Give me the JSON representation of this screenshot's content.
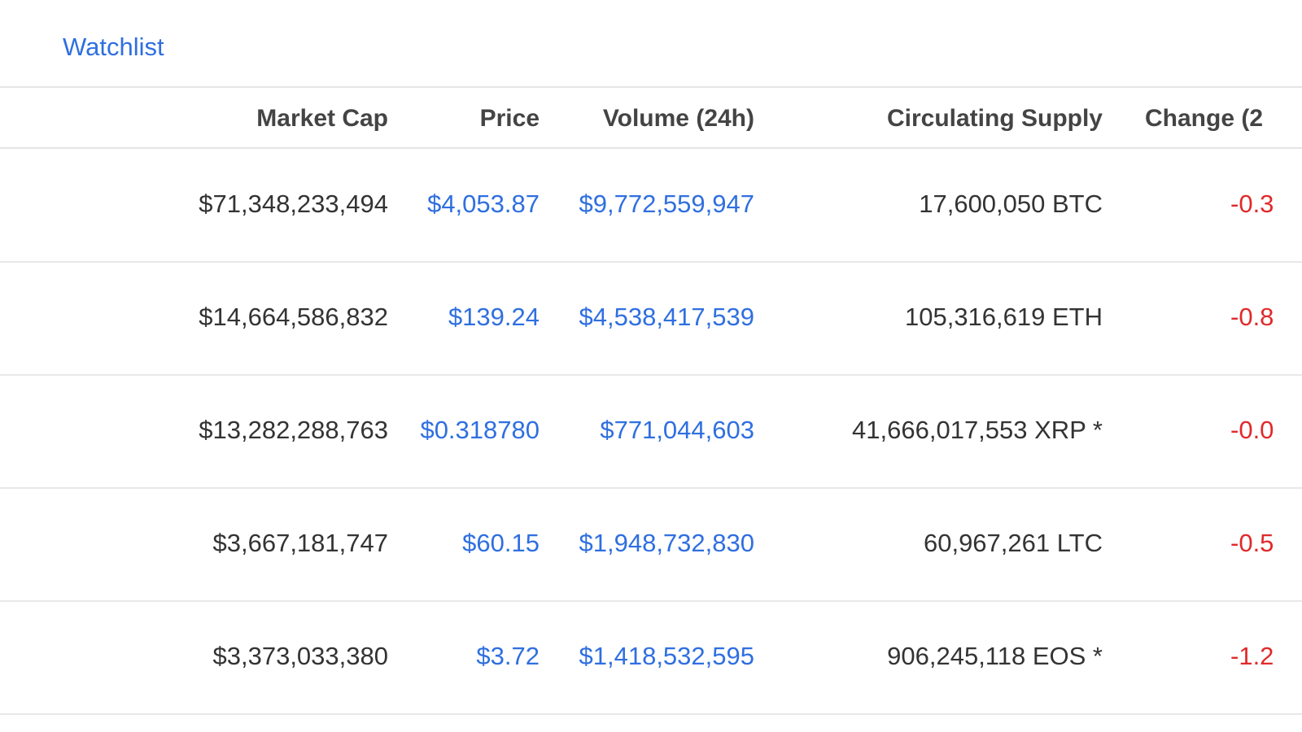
{
  "nav": {
    "watchlist_label": "Watchlist"
  },
  "table": {
    "headers": {
      "market_cap": "Market Cap",
      "price": "Price",
      "volume": "Volume (24h)",
      "supply": "Circulating Supply",
      "change": "Change (2"
    },
    "rows": [
      {
        "market_cap": "$71,348,233,494",
        "price": "$4,053.87",
        "volume": "$9,772,559,947",
        "supply": "17,600,050 BTC",
        "change": "-0.3"
      },
      {
        "market_cap": "$14,664,586,832",
        "price": "$139.24",
        "volume": "$4,538,417,539",
        "supply": "105,316,619 ETH",
        "change": "-0.8"
      },
      {
        "market_cap": "$13,282,288,763",
        "price": "$0.318780",
        "volume": "$771,044,603",
        "supply": "41,666,017,553 XRP *",
        "change": "-0.0"
      },
      {
        "market_cap": "$3,667,181,747",
        "price": "$60.15",
        "volume": "$1,948,732,830",
        "supply": "60,967,261 LTC",
        "change": "-0.5"
      },
      {
        "market_cap": "$3,373,033,380",
        "price": "$3.72",
        "volume": "$1,418,532,595",
        "supply": "906,245,118 EOS *",
        "change": "-1.2"
      }
    ]
  },
  "colors": {
    "link": "#2f6fe0",
    "negative": "#e02a2a",
    "text": "#333333",
    "border": "#e5e5e5"
  }
}
